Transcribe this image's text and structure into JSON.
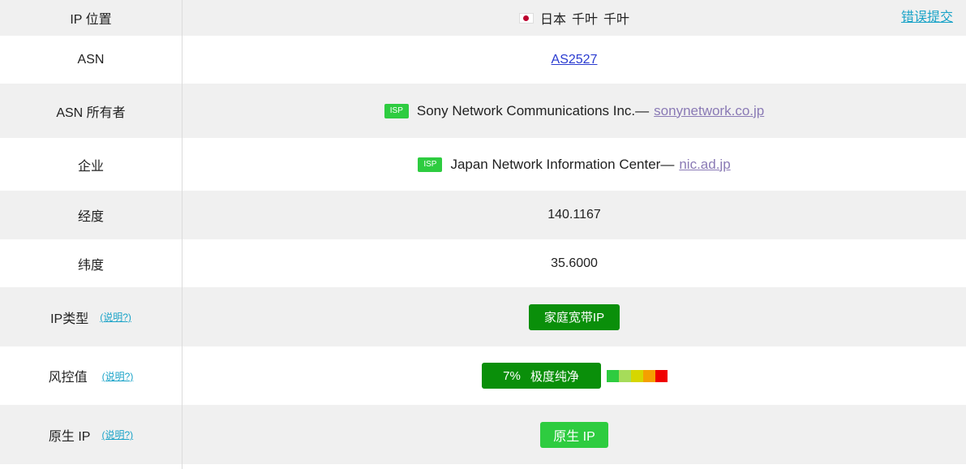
{
  "rows": [
    {
      "label": "IP 位置",
      "country": "日本",
      "region": "千叶",
      "city": "千叶",
      "report": "错误提交"
    },
    {
      "label": "ASN",
      "value": "AS2527"
    },
    {
      "label": "ASN 所有者",
      "badge": "ISP",
      "name": "Sony Network Communications Inc.—",
      "domain": "sonynetwork.co.jp"
    },
    {
      "label": "企业",
      "badge": "ISP",
      "name": "Japan Network Information Center—",
      "domain": "nic.ad.jp"
    },
    {
      "label": "经度",
      "value": "140.1167"
    },
    {
      "label": "纬度",
      "value": "35.6000"
    },
    {
      "label": "IP类型",
      "help": "(说明?)",
      "value": "家庭宽带IP"
    },
    {
      "label": "风控值",
      "help": "(说明?)",
      "percent": "7%",
      "rating": "极度纯净"
    },
    {
      "label": "原生 IP",
      "help": "(说明?)",
      "value": "原生 IP"
    }
  ],
  "colors": {
    "risk_scale": [
      "#2ecc40",
      "#a6dc5a",
      "#d6d600",
      "#f5a000",
      "#f00000"
    ],
    "badge_green": "#2ecc40",
    "button_dark_green": "#0a8f0a",
    "link_cyan": "#1aa3c8"
  },
  "icons": {
    "flag": "japan-flag-icon"
  }
}
